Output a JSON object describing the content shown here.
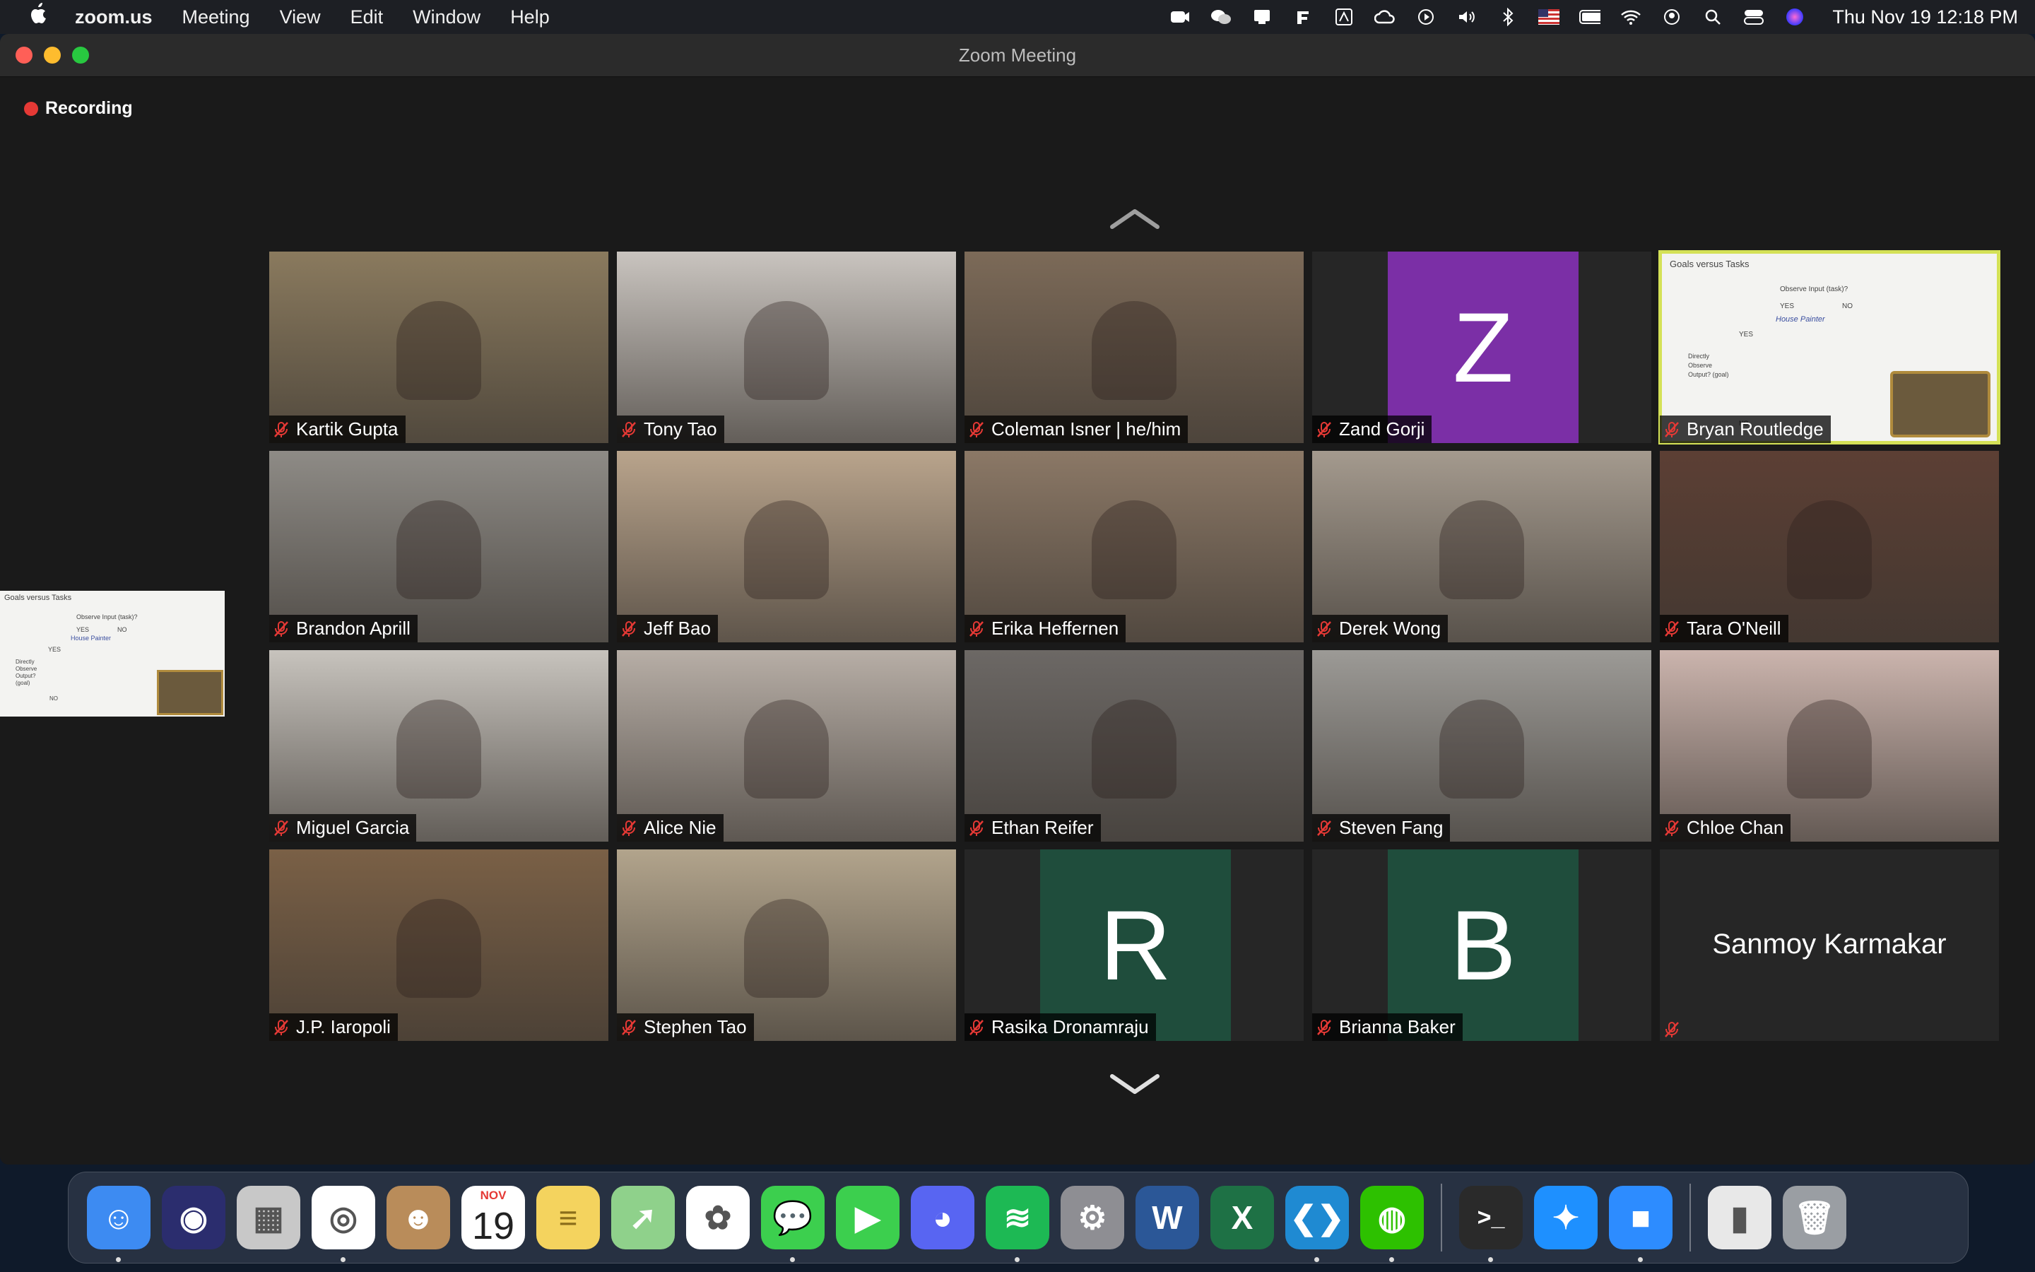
{
  "menubar": {
    "app": "zoom.us",
    "items": [
      "Meeting",
      "View",
      "Edit",
      "Window",
      "Help"
    ],
    "clock": "Thu Nov 19  12:18 PM",
    "status_icons": [
      "zoom-camera-icon",
      "wechat-icon",
      "notification-icon",
      "fantastical-icon",
      "acrobat-icon",
      "creative-cloud-icon",
      "play-icon",
      "volume-icon",
      "bluetooth-icon",
      "flag-us-icon",
      "battery-icon",
      "wifi-icon",
      "user-icon",
      "search-icon",
      "control-center-icon",
      "siri-icon"
    ]
  },
  "window": {
    "title": "Zoom Meeting",
    "recording_label": "Recording"
  },
  "slide": {
    "title": "Goals versus Tasks",
    "lines": [
      "Observe Input (task)?",
      "YES",
      "NO",
      "House Painter",
      "YES",
      "Directly Observe Output? (goal)",
      "NO"
    ]
  },
  "participants": [
    {
      "name": "Kartik Gupta",
      "kind": "video",
      "bg": "#8a7a5e"
    },
    {
      "name": "Tony Tao",
      "kind": "video",
      "bg": "#c9c4bf"
    },
    {
      "name": "Coleman Isner | he/him",
      "kind": "video",
      "bg": "#7c6a58"
    },
    {
      "name": "Zand Gorji",
      "kind": "avatar",
      "letter": "Z",
      "bg": "#7b2fa6"
    },
    {
      "name": "Bryan Routledge",
      "kind": "share",
      "bg": "#f3f3f1"
    },
    {
      "name": "Brandon Aprill",
      "kind": "video",
      "bg": "#8e8b86"
    },
    {
      "name": "Jeff Bao",
      "kind": "video",
      "bg": "#b9a48c"
    },
    {
      "name": "Erika Heffernen",
      "kind": "video",
      "bg": "#8b7866"
    },
    {
      "name": "Derek Wong",
      "kind": "video",
      "bg": "#a49a8e"
    },
    {
      "name": "Tara O'Neill",
      "kind": "video",
      "bg": "#5c3f34"
    },
    {
      "name": "Miguel Garcia",
      "kind": "video",
      "bg": "#c7c3bd"
    },
    {
      "name": "Alice Nie",
      "kind": "video",
      "bg": "#b7aea6"
    },
    {
      "name": "Ethan Reifer",
      "kind": "video",
      "bg": "#6c6865"
    },
    {
      "name": "Steven Fang",
      "kind": "video",
      "bg": "#9c9a96"
    },
    {
      "name": "Chloe Chan",
      "kind": "video",
      "bg": "#cbb4ad"
    },
    {
      "name": "J.P. Iaropoli",
      "kind": "video",
      "bg": "#7a6046"
    },
    {
      "name": "Stephen Tao",
      "kind": "video",
      "bg": "#b2a48c"
    },
    {
      "name": "Rasika Dronamraju",
      "kind": "avatar",
      "letter": "R",
      "bg": "#1f4d3c"
    },
    {
      "name": "Brianna Baker",
      "kind": "avatar",
      "letter": "B",
      "bg": "#1f4d3c"
    },
    {
      "name": "Sanmoy Karmakar",
      "kind": "nameonly",
      "bg": "#262626"
    }
  ],
  "calendar": {
    "month": "NOV",
    "day": "19"
  },
  "dock": {
    "apps": [
      {
        "name": "finder",
        "color": "#3d8bf2",
        "glyph": "☺",
        "running": true
      },
      {
        "name": "siri",
        "color": "#2b2d6e",
        "glyph": "◉",
        "running": false
      },
      {
        "name": "launchpad",
        "color": "#c8c8c8",
        "glyph": "▦",
        "running": false
      },
      {
        "name": "chrome",
        "color": "#ffffff",
        "glyph": "◎",
        "running": true
      },
      {
        "name": "contacts",
        "color": "#b98c5a",
        "glyph": "☻",
        "running": false
      },
      {
        "name": "calendar",
        "color": "#ffffff",
        "glyph": "",
        "running": false
      },
      {
        "name": "notes",
        "color": "#f4d35e",
        "glyph": "≡",
        "running": false
      },
      {
        "name": "maps",
        "color": "#8fd18b",
        "glyph": "➚",
        "running": false
      },
      {
        "name": "photos",
        "color": "#ffffff",
        "glyph": "✿",
        "running": false
      },
      {
        "name": "messages",
        "color": "#3ccf4e",
        "glyph": "💬",
        "running": true
      },
      {
        "name": "facetime",
        "color": "#3ccf4e",
        "glyph": "▶",
        "running": false
      },
      {
        "name": "discord",
        "color": "#5865f2",
        "glyph": "◕",
        "running": false
      },
      {
        "name": "spotify",
        "color": "#1db954",
        "glyph": "≋",
        "running": true
      },
      {
        "name": "system-preferences",
        "color": "#8e8e93",
        "glyph": "⚙",
        "running": false
      },
      {
        "name": "word",
        "color": "#2b5797",
        "glyph": "W",
        "running": false
      },
      {
        "name": "excel",
        "color": "#1e7145",
        "glyph": "X",
        "running": false
      },
      {
        "name": "vscode",
        "color": "#1f8ad2",
        "glyph": "❮❯",
        "running": true
      },
      {
        "name": "wechat",
        "color": "#2dc100",
        "glyph": "◍",
        "running": true
      }
    ],
    "apps_right": [
      {
        "name": "terminal",
        "color": "#2a2a2a",
        "glyph": ">_",
        "running": true
      },
      {
        "name": "safari",
        "color": "#1e90ff",
        "glyph": "✦",
        "running": false
      },
      {
        "name": "zoom",
        "color": "#2d8cff",
        "glyph": "■",
        "running": true
      }
    ],
    "apps_far": [
      {
        "name": "archive",
        "color": "#e8e8e8",
        "glyph": "▮",
        "running": false
      },
      {
        "name": "trash",
        "color": "#9a9ea3",
        "glyph": "🗑",
        "running": false
      }
    ]
  },
  "colors": {
    "mute": "#e53935",
    "active_speaker": "#d4e157",
    "recording": "#e53935"
  }
}
